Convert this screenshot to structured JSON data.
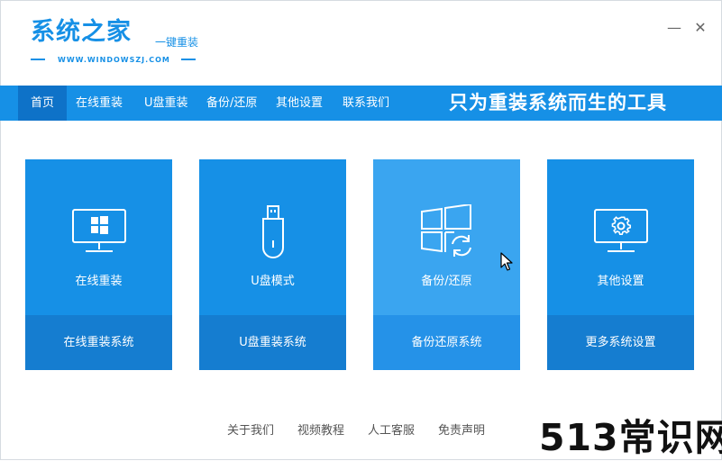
{
  "app": {
    "logo_title": "系统之家",
    "logo_subtitle": "一键重装",
    "logo_url": "WWW.WINDOWSZJ.COM"
  },
  "window_controls": {
    "minimize": "—",
    "close": "✕"
  },
  "nav": {
    "items": [
      {
        "label": "首页",
        "active": true
      },
      {
        "label": "在线重装"
      },
      {
        "label": "U盘重装"
      },
      {
        "label": "备份/还原"
      },
      {
        "label": "其他设置"
      },
      {
        "label": "联系我们"
      }
    ],
    "slogan": "只为重装系统而生的工具"
  },
  "cards": [
    {
      "icon": "monitor-windows-icon",
      "label": "在线重装",
      "action": "在线重装系统"
    },
    {
      "icon": "usb-drive-icon",
      "label": "U盘模式",
      "action": "U盘重装系统"
    },
    {
      "icon": "windows-restore-icon",
      "label": "备份/还原",
      "action": "备份还原系统"
    },
    {
      "icon": "monitor-gear-icon",
      "label": "其他设置",
      "action": "更多系统设置"
    }
  ],
  "footer": {
    "links": [
      "关于我们",
      "视频教程",
      "人工客服",
      "免责声明"
    ]
  },
  "watermark": "513常识网",
  "colors": {
    "primary": "#1690e6",
    "primary_dark": "#157dd0",
    "nav_active": "#0e72c8",
    "card_hover": "#3aa5f0"
  }
}
